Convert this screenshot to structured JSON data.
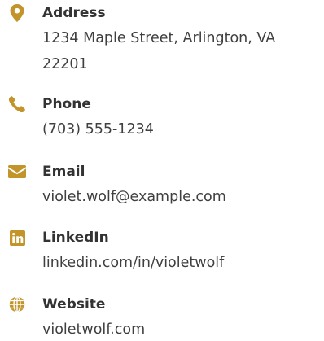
{
  "accent_color": "#c2942a",
  "contacts": [
    {
      "icon": "map-pin-icon",
      "label": "Address",
      "value": "1234 Maple Street, Arlington, VA 22201"
    },
    {
      "icon": "phone-icon",
      "label": "Phone",
      "value": "(703) 555-1234"
    },
    {
      "icon": "envelope-icon",
      "label": "Email",
      "value": "violet.wolf@example.com"
    },
    {
      "icon": "linkedin-icon",
      "label": "LinkedIn",
      "value": "linkedin.com/in/violetwolf"
    },
    {
      "icon": "globe-icon",
      "label": "Website",
      "value": "violetwolf.com"
    }
  ]
}
